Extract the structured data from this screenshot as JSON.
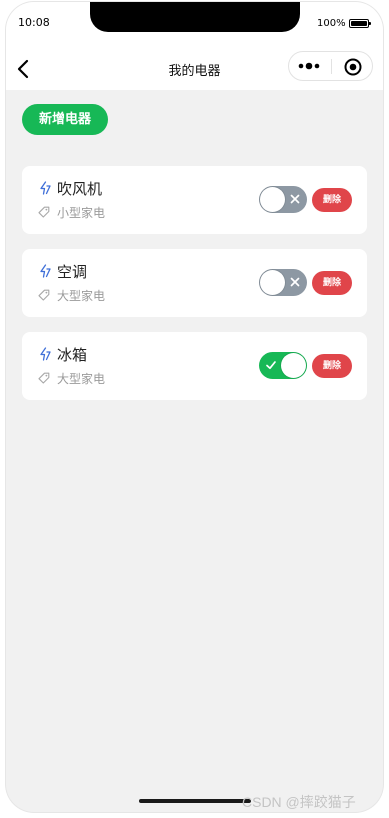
{
  "status_bar": {
    "time": "10:08",
    "battery_percent": "100%"
  },
  "nav": {
    "title": "我的电器"
  },
  "actions": {
    "add_label": "新增电器"
  },
  "appliances": [
    {
      "name": "吹风机",
      "type": "小型家电",
      "power_on": false,
      "delete_label": "删除"
    },
    {
      "name": "空调",
      "type": "大型家电",
      "power_on": false,
      "delete_label": "删除"
    },
    {
      "name": "冰箱",
      "type": "大型家电",
      "power_on": true,
      "delete_label": "删除"
    }
  ],
  "watermark": "CSDN @摔跤猫子",
  "colors": {
    "accent_green": "#17b856",
    "danger_red": "#e0454a",
    "switch_off_gray": "#8d98a3",
    "icon_blue": "#3f6fd8",
    "background": "#f1f1f1"
  },
  "icons": {
    "back": "chevron-left-icon",
    "more": "more-dots-icon",
    "close": "target-circle-icon",
    "appliance": "lightning-bolt-icon",
    "category": "tag-icon"
  }
}
